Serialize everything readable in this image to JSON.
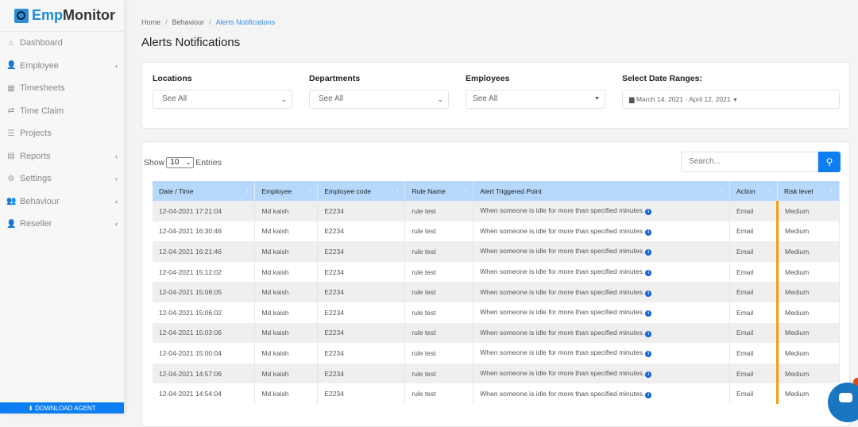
{
  "app": {
    "logo_prefix": "Emp",
    "logo_suffix": "Monitor"
  },
  "sidebar": {
    "items": [
      {
        "label": "Dashboard",
        "icon": "home-icon",
        "chevron": false
      },
      {
        "label": "Employee",
        "icon": "user-icon",
        "chevron": true
      },
      {
        "label": "Timesheets",
        "icon": "calendar-icon",
        "chevron": false
      },
      {
        "label": "Time Claim",
        "icon": "exchange-icon",
        "chevron": false
      },
      {
        "label": "Projects",
        "icon": "list-icon",
        "chevron": false
      },
      {
        "label": "Reports",
        "icon": "report-icon",
        "chevron": true
      },
      {
        "label": "Settings",
        "icon": "gear-icon",
        "chevron": true
      },
      {
        "label": "Behaviour",
        "icon": "user-gear-icon",
        "chevron": true
      },
      {
        "label": "Reseller",
        "icon": "user-icon",
        "chevron": true
      }
    ],
    "download_label": "DOWNLOAD AGENT"
  },
  "breadcrumb": [
    "Home",
    "Behaviour",
    "Alerts Notifications"
  ],
  "page_title": "Alerts Notifications",
  "filters": {
    "locations": {
      "label": "Locations",
      "value": "See All"
    },
    "departments": {
      "label": "Departments",
      "value": "See All"
    },
    "employees": {
      "label": "Employees",
      "value": "See All"
    },
    "date": {
      "label": "Select Date Ranges:",
      "value": "March 14, 2021 - April 12, 2021"
    }
  },
  "table": {
    "show_label": "Show",
    "entries_value": "10",
    "entries_label": "Entries",
    "search_placeholder": "Search...",
    "columns": [
      "Date / Time",
      "Employee",
      "Employee code",
      "Rule Name",
      "Alert Triggered Point",
      "Action",
      "Risk level"
    ],
    "rows": [
      [
        "12-04-2021 17:21:04",
        "Md kaish",
        "E2234",
        "rule test",
        "When someone is idle for more than specified minutes.",
        "Email",
        "Medium"
      ],
      [
        "12-04-2021 16:30:46",
        "Md kaish",
        "E2234",
        "rule test",
        "When someone is idle for more than specified minutes.",
        "Email",
        "Medium"
      ],
      [
        "12-04-2021 16:21:46",
        "Md kaish",
        "E2234",
        "rule test",
        "When someone is idle for more than specified minutes.",
        "Email",
        "Medium"
      ],
      [
        "12-04-2021 15:12:02",
        "Md kaish",
        "E2234",
        "rule test",
        "When someone is idle for more than specified minutes.",
        "Email",
        "Medium"
      ],
      [
        "12-04-2021 15:09:05",
        "Md kaish",
        "E2234",
        "rule test",
        "When someone is idle for more than specified minutes.",
        "Email",
        "Medium"
      ],
      [
        "12-04-2021 15:06:02",
        "Md kaish",
        "E2234",
        "rule test",
        "When someone is idle for more than specified minutes.",
        "Email",
        "Medium"
      ],
      [
        "12-04-2021 15:03:06",
        "Md kaish",
        "E2234",
        "rule test",
        "When someone is idle for more than specified minutes.",
        "Email",
        "Medium"
      ],
      [
        "12-04-2021 15:00:04",
        "Md kaish",
        "E2234",
        "rule test",
        "When someone is idle for more than specified minutes.",
        "Email",
        "Medium"
      ],
      [
        "12-04-2021 14:57:06",
        "Md kaish",
        "E2234",
        "rule test",
        "When someone is idle for more than specified minutes.",
        "Email",
        "Medium"
      ],
      [
        "12-04-2021 14:54:04",
        "Md kaish",
        "E2234",
        "rule test",
        "When someone is idle for more than specified minutes.",
        "Email",
        "Medium"
      ]
    ]
  },
  "colors": {
    "accent": "#0d7ef2",
    "header": "#b5d8fb",
    "risk_medium": "#f5a00a"
  }
}
